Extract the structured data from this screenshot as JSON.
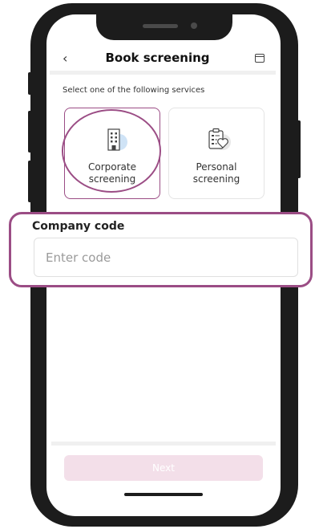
{
  "header": {
    "back_icon": "chevron-left-icon",
    "title": "Book screening",
    "calendar_icon": "calendar-icon"
  },
  "subtitle": "Select one of the following services",
  "services": [
    {
      "label_line1": "Corporate",
      "label_line2": "screening",
      "icon": "building-icon",
      "selected": true
    },
    {
      "label_line1": "Personal",
      "label_line2": "screening",
      "icon": "clipboard-heart-icon",
      "selected": false
    }
  ],
  "company": {
    "label": "Company code",
    "placeholder": "Enter code",
    "value": ""
  },
  "footer": {
    "next_label": "Next",
    "next_enabled": false
  },
  "colors": {
    "accent": "#9b4d85",
    "button_disabled": "#f3dfe9",
    "icon_tint": "#cfe3f6"
  }
}
